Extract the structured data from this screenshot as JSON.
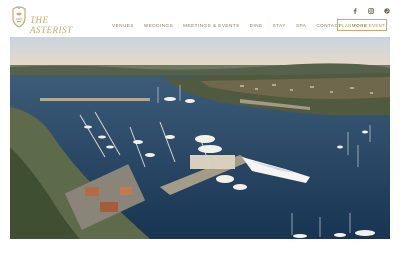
{
  "brand": {
    "name": "THE ASTERIST",
    "crest_icon": "crest-icon",
    "accent_color": "#c3aa78"
  },
  "social": [
    {
      "icon": "facebook-icon",
      "glyph": "f"
    },
    {
      "icon": "instagram-icon",
      "glyph": "◎"
    },
    {
      "icon": "pinterest-icon",
      "glyph": "p"
    }
  ],
  "nav": {
    "items": [
      "VENUES",
      "WEDDINGS",
      "MEETINGS & EVENTS",
      "DINE",
      "STAY",
      "SPA",
      "CONTACT",
      "MORE"
    ],
    "cta_label": "PLAN YOUR EVENT"
  },
  "hero": {
    "image_icon": "aerial-harbor-photo"
  }
}
